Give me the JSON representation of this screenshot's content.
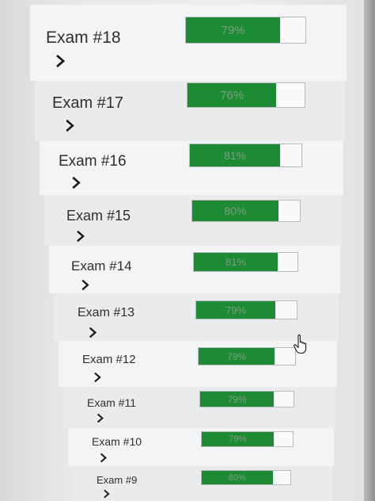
{
  "exams": [
    {
      "title": "Exam #18",
      "score_label": "79%",
      "score": 79
    },
    {
      "title": "Exam #17",
      "score_label": "76%",
      "score": 76
    },
    {
      "title": "Exam #16",
      "score_label": "81%",
      "score": 81
    },
    {
      "title": "Exam #15",
      "score_label": "80%",
      "score": 80
    },
    {
      "title": "Exam #14",
      "score_label": "81%",
      "score": 81
    },
    {
      "title": "Exam #13",
      "score_label": "79%",
      "score": 79
    },
    {
      "title": "Exam #12",
      "score_label": "79%",
      "score": 79
    },
    {
      "title": "Exam #11",
      "score_label": "79%",
      "score": 79
    },
    {
      "title": "Exam #10",
      "score_label": "79%",
      "score": 79
    },
    {
      "title": "Exam #9",
      "score_label": "80%",
      "score": 80
    }
  ],
  "colors": {
    "progress_fill": "#1d8a34",
    "progress_track": "#fafafa"
  },
  "icons": {
    "expand": "chevron-right-icon",
    "cursor": "hand-pointer-icon"
  }
}
